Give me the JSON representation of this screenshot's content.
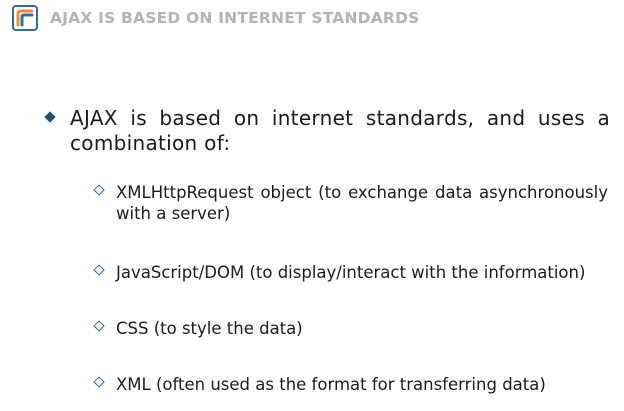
{
  "header": {
    "title": "AJAX IS BASED ON INTERNET STANDARDS",
    "logo_icon": "slide-logo-icon",
    "colors": {
      "title": "#b3b3b3",
      "logo_blue": "#2e6da4",
      "logo_orange": "#f28c28"
    }
  },
  "content": {
    "main_bullet": "AJAX is based on internet standards, and uses a combination of:",
    "sub_bullets": [
      "XMLHttpRequest object (to exchange data asynchronously with a server)",
      "JavaScript/DOM (to display/interact with the information)",
      "CSS (to style the data)",
      "XML (often used as the format for transferring data)"
    ],
    "colors": {
      "main_marker": "#1f4e79",
      "sub_marker": "#2e6da4"
    }
  }
}
